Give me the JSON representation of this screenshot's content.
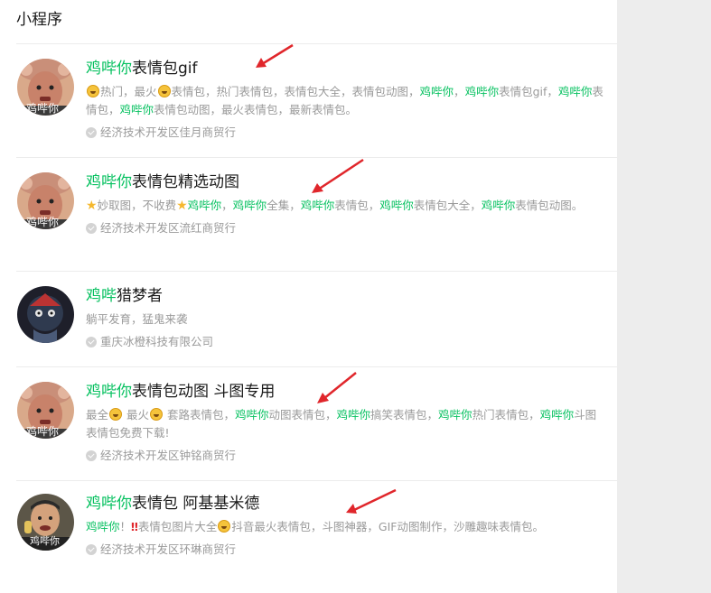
{
  "section_title": "小程序",
  "results": [
    {
      "title_highlight": "鸡哔你",
      "title_rest": "表情包gif",
      "avatar_label": "鸡哔你",
      "desc_segments": [
        {
          "emoji": "grin-emoji"
        },
        {
          "text": "热门，最火"
        },
        {
          "emoji": "grin-emoji"
        },
        {
          "text": "表情包，热门表情包，表情包大全，表情包动图，"
        },
        {
          "hl": "鸡哔你"
        },
        {
          "text": "，"
        },
        {
          "hl": "鸡哔你"
        },
        {
          "text": "表情包gif，"
        },
        {
          "hl": "鸡哔你"
        },
        {
          "text": "表情包，"
        },
        {
          "hl": "鸡哔你"
        },
        {
          "text": "表情包动图，最火表情包，最新表情包。"
        }
      ],
      "org": "经济技术开发区佳月商贸行"
    },
    {
      "title_highlight": "鸡哔你",
      "title_rest": "表情包精选动图",
      "avatar_label": "鸡哔你",
      "desc_segments": [
        {
          "star": "★"
        },
        {
          "text": "妙取图，不收费"
        },
        {
          "star": "★"
        },
        {
          "hl": "鸡哔你"
        },
        {
          "text": "，"
        },
        {
          "hl": "鸡哔你"
        },
        {
          "text": "全集，"
        },
        {
          "hl": "鸡哔你"
        },
        {
          "text": "表情包，"
        },
        {
          "hl": "鸡哔你"
        },
        {
          "text": "表情包大全，"
        },
        {
          "hl": "鸡哔你"
        },
        {
          "text": "表情包动图。"
        }
      ],
      "org": "经济技术开发区流红商贸行"
    },
    {
      "title_highlight": "鸡哔",
      "title_rest": "猎梦者",
      "avatar_label": "",
      "desc_segments": [
        {
          "text": "躺平发育，猛鬼来袭"
        }
      ],
      "org": "重庆冰橙科技有限公司"
    },
    {
      "title_highlight": "鸡哔你",
      "title_rest": "表情包动图 斗图专用",
      "avatar_label": "鸡哔你",
      "desc_segments": [
        {
          "text": "最全"
        },
        {
          "emoji": "grin-emoji"
        },
        {
          "text": " 最火"
        },
        {
          "emoji": "grin-emoji"
        },
        {
          "text": " 套路表情包，"
        },
        {
          "hl": "鸡哔你"
        },
        {
          "text": "动图表情包，"
        },
        {
          "hl": "鸡哔你"
        },
        {
          "text": "搞笑表情包，"
        },
        {
          "hl": "鸡哔你"
        },
        {
          "text": "热门表情包，"
        },
        {
          "hl": "鸡哔你"
        },
        {
          "text": "斗图表情包免费下载!"
        }
      ],
      "org": "经济技术开发区钟铭商贸行"
    },
    {
      "title_highlight": "鸡哔你",
      "title_rest": "表情包 阿基基米德",
      "avatar_label": "鸡哔你",
      "desc_segments": [
        {
          "hl": "鸡哔你"
        },
        {
          "text": "！"
        },
        {
          "excl": "‼"
        },
        {
          "text": "表情包图片大全"
        },
        {
          "emoji": "grin-emoji"
        },
        {
          "text": "抖音最火表情包，斗图神器，GIF动图制作，沙雕趣味表情包。"
        }
      ],
      "org": "经济技术开发区环琳商贸行"
    }
  ],
  "colors": {
    "highlight": "#07c160",
    "arrow": "#e0262b",
    "muted": "#9a9a9a"
  }
}
